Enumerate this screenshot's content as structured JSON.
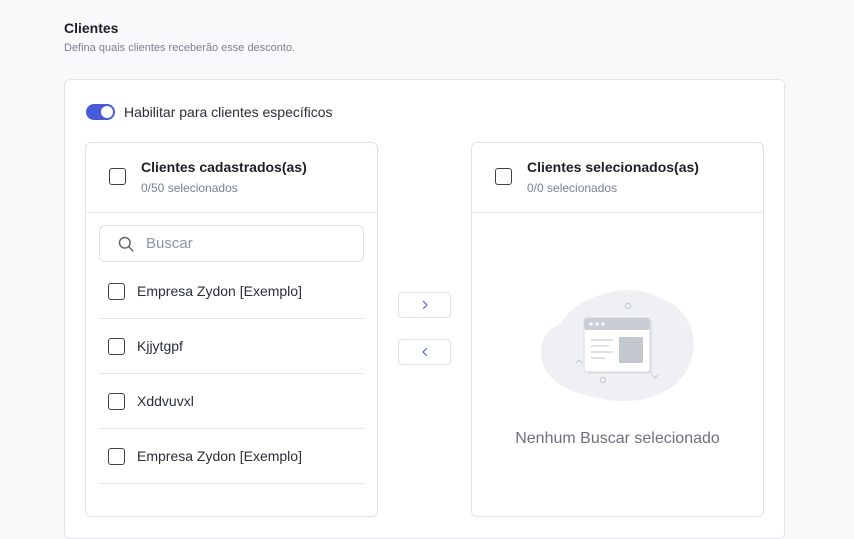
{
  "section": {
    "title": "Clientes",
    "subtitle": "Defina quais clientes receberão esse desconto."
  },
  "toggle": {
    "label": "Habilitar para clientes específicos",
    "enabled": true,
    "color": "#4a5bd9"
  },
  "source_panel": {
    "title": "Clientes cadastrados(as)",
    "count": "0/50 selecionados",
    "search_placeholder": "Buscar",
    "items": [
      {
        "label": "Empresa Zydon [Exemplo]"
      },
      {
        "label": "Kjjytgpf"
      },
      {
        "label": "Xddvuvxl"
      },
      {
        "label": "Empresa Zydon [Exemplo]"
      }
    ]
  },
  "transfer": {
    "next_icon": "chevron-right-icon",
    "prev_icon": "chevron-left-icon"
  },
  "target_panel": {
    "title": "Clientes selecionados(as)",
    "count": "0/0 selecionados",
    "empty_icon": "empty-window-illustration",
    "empty_text": "Nenhum Buscar selecionado"
  }
}
